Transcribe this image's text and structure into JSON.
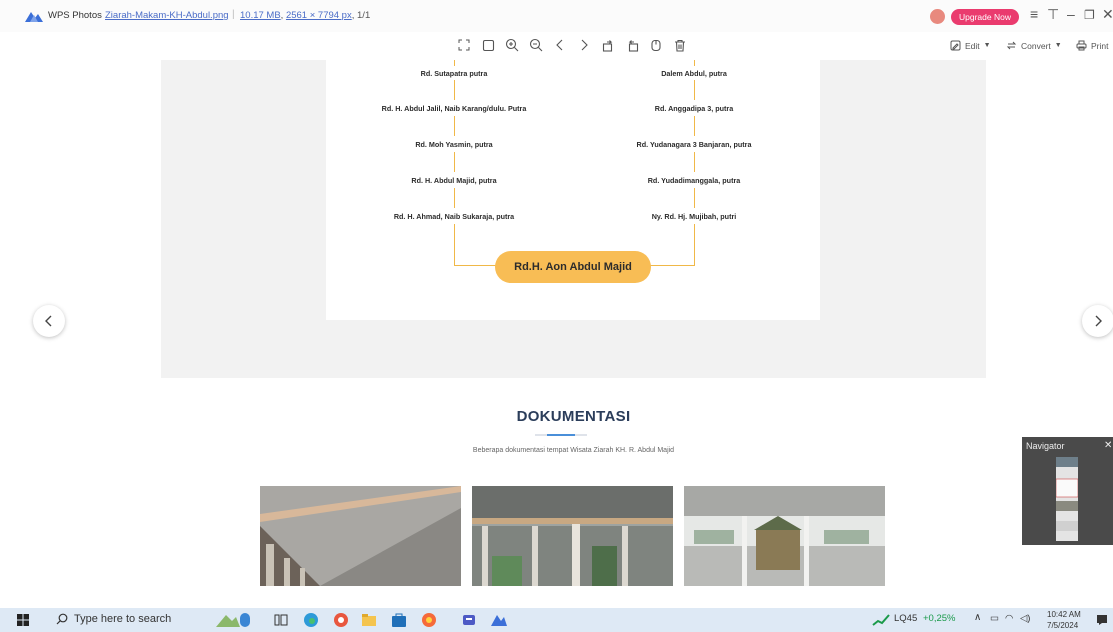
{
  "app": {
    "name": "WPS Photos",
    "file_name": "Ziarah-Makam-KH-Abdul.png",
    "file_size": "10.17 MB",
    "dimensions": "2561 × 7794 px",
    "page_index": "1/1",
    "upgrade_label": "Upgrade Now",
    "edit_label": "Edit",
    "convert_label": "Convert",
    "print_label": "Print"
  },
  "tree": {
    "left": [
      "Rd. Sutapatra putra",
      "Rd. H. Abdul Jalil, Naib Karang/dulu. Putra",
      "Rd. Moh Yasmin, putra",
      "Rd. H. Abdul Majid, putra",
      "Rd. H. Ahmad, Naib Sukaraja, putra"
    ],
    "right": [
      "Dalem Abdul, putra",
      "Rd. Anggadipa 3, putra",
      "Rd. Yudanagara 3 Banjaran, putra",
      "Rd. Yudadimanggala, putra",
      "Ny. Rd. Hj. Mujibah, putri"
    ],
    "root": "Rd.H. Aon Abdul Majid"
  },
  "documentation": {
    "title": "DOKUMENTASI",
    "subtitle": "Beberapa dokumentasi tempat Wisata Ziarah KH. R. Abdul Majid"
  },
  "navigator": {
    "title": "Navigator"
  },
  "taskbar": {
    "search_placeholder": "Type here to search",
    "stock": "LQ45",
    "stock_change": "+0,25%",
    "time": "10:42 AM",
    "date": "7/5/2024"
  },
  "colors": {
    "tree_line": "#f0b848",
    "root_node": "#f8bd55",
    "upgrade": "#ea3b6e",
    "stock_up": "#1a9a4a"
  }
}
